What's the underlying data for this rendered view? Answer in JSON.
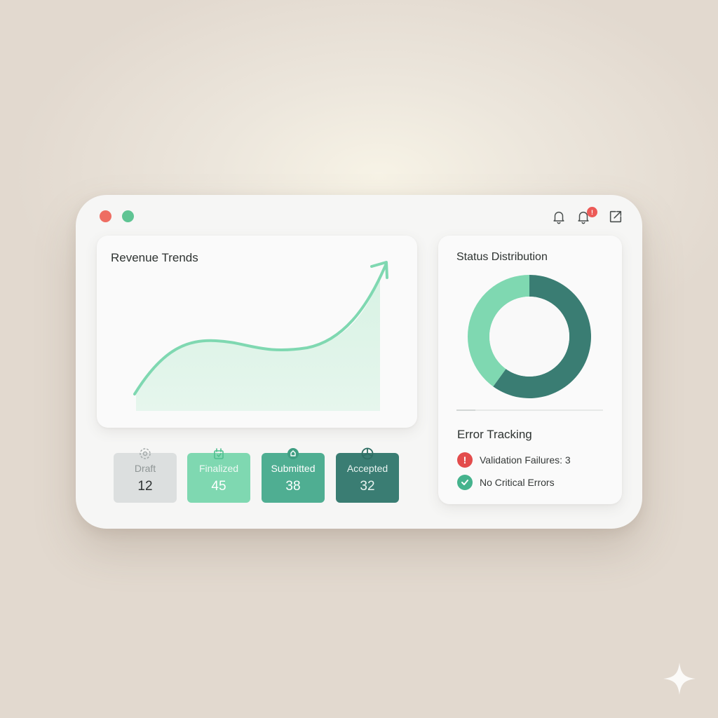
{
  "toolbar": {
    "notification_badge": "!",
    "icons": [
      "bell-icon",
      "bell-alert-icon",
      "external-link-icon"
    ]
  },
  "revenue": {
    "title": "Revenue Trends"
  },
  "stats": [
    {
      "label": "Draft",
      "value": "12",
      "icon": "draft-icon"
    },
    {
      "label": "Finalized",
      "value": "45",
      "icon": "finalized-icon"
    },
    {
      "label": "Submitted",
      "value": "38",
      "icon": "submitted-icon"
    },
    {
      "label": "Accepted",
      "value": "32",
      "icon": "accepted-icon"
    }
  ],
  "status": {
    "title": "Status Distribution",
    "segments": [
      {
        "status": "Accepted",
        "fraction": 0.6,
        "color": "#3a7d73"
      },
      {
        "status": "Finalized",
        "fraction": 0.4,
        "color": "#7fd8b1"
      }
    ],
    "progress_fraction": 0.13
  },
  "errors": {
    "title": "Error Tracking",
    "validation": "Validation Failures: 3",
    "critical": "No Critical Errors"
  },
  "colors": {
    "accent_green": "#7fd8b1",
    "teal": "#4fae92",
    "dark_teal": "#3a7d73",
    "error_red": "#e34c4c"
  }
}
